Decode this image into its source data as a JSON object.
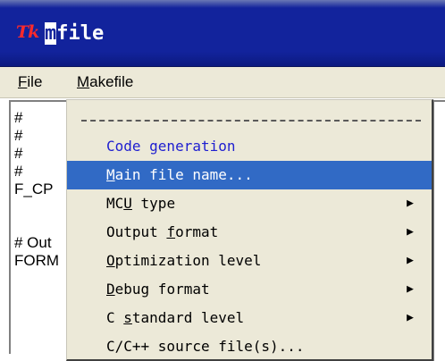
{
  "window": {
    "icon": "tk-icon",
    "icon_text": "Tk",
    "title_first_char": "m",
    "title_rest": "file"
  },
  "menubar": {
    "file_ul": "F",
    "file_rest": "ile",
    "makefile_ul": "M",
    "makefile_rest": "akefile"
  },
  "background_text": [
    "#",
    "#",
    "#",
    "#",
    "F_CP",
    "",
    "",
    "# Out",
    "FORM"
  ],
  "dropdown": {
    "items": [
      {
        "label": "Code generation",
        "type": "heading"
      },
      {
        "pre": "",
        "ul": "M",
        "post": "ain file name...",
        "selected": true
      },
      {
        "pre": "MC",
        "ul": "U",
        "post": " type",
        "submenu": true
      },
      {
        "pre": "Output ",
        "ul": "f",
        "post": "ormat",
        "submenu": true
      },
      {
        "pre": "",
        "ul": "O",
        "post": "ptimization level",
        "submenu": true
      },
      {
        "pre": "",
        "ul": "D",
        "post": "ebug format",
        "submenu": true
      },
      {
        "pre": "C ",
        "ul": "s",
        "post": "tandard level",
        "submenu": true
      },
      {
        "pre": "C/C++ source file(s)...",
        "ul": "",
        "post": ""
      }
    ]
  },
  "colors": {
    "titlebar": "#12239c",
    "selection": "#316ac5",
    "heading_text": "#2020d0",
    "menu_bg": "#ece9d8"
  }
}
